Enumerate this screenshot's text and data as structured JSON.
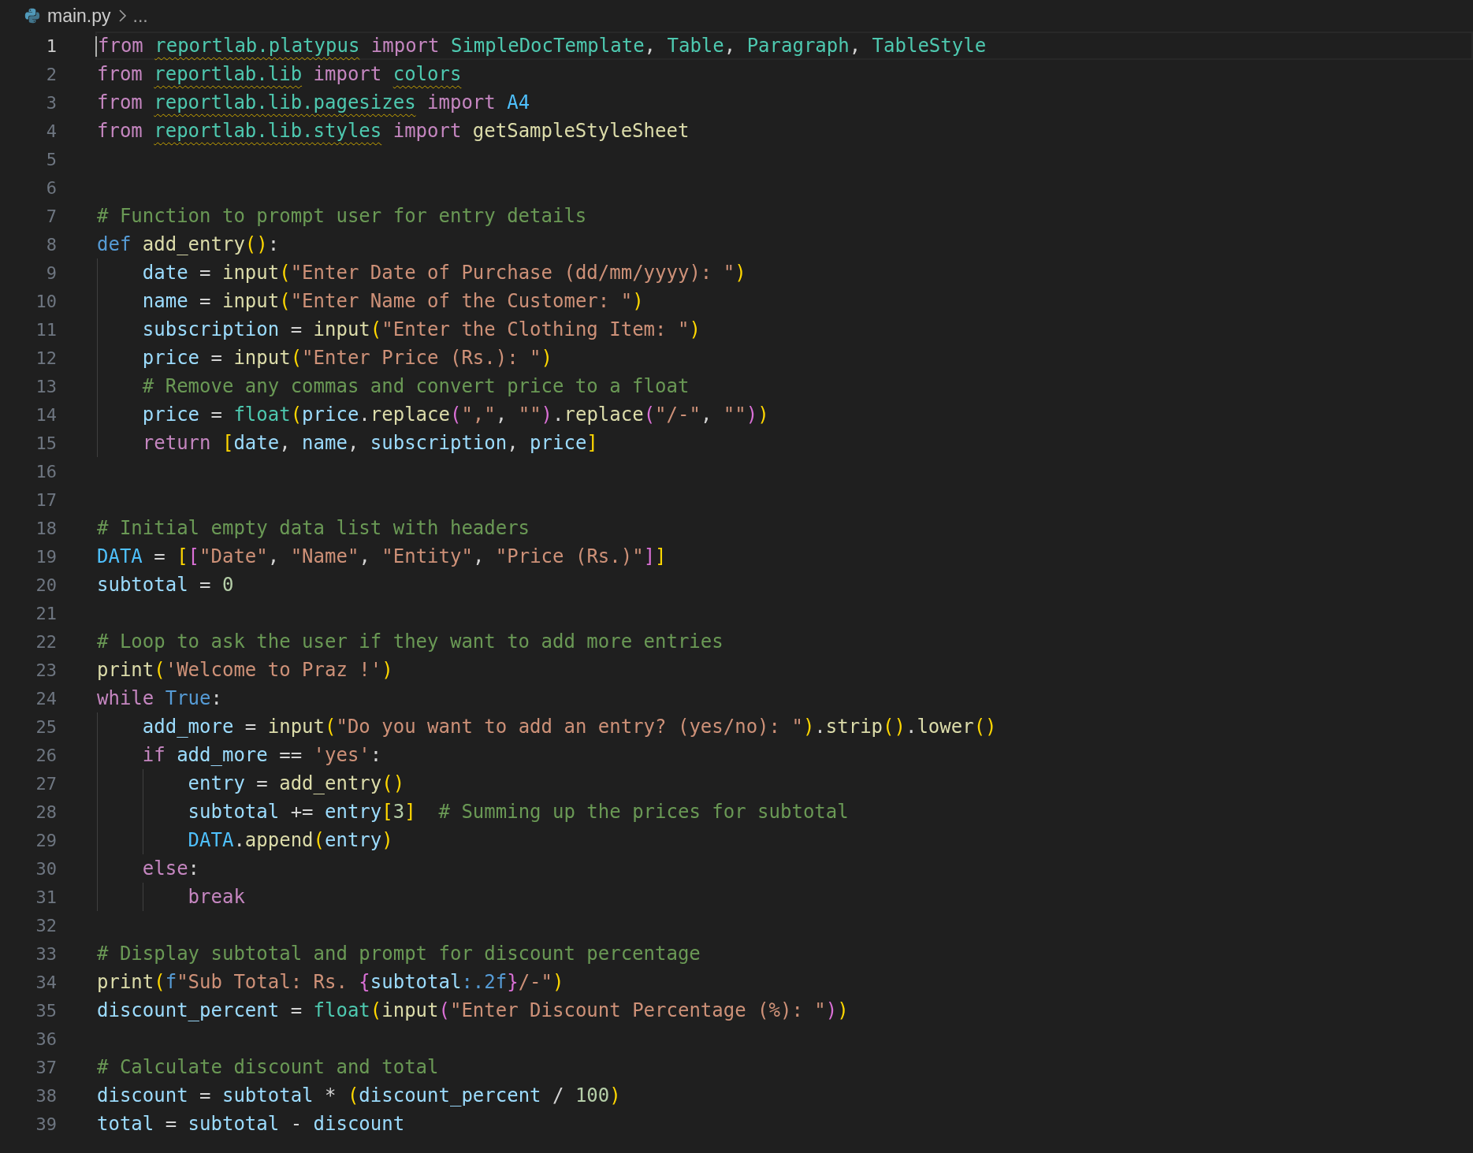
{
  "breadcrumb": {
    "file": "main.py",
    "trail": "..."
  },
  "lines": [
    {
      "number": "1",
      "current": true,
      "tokens": [
        {
          "kind": "kw",
          "text": "from "
        },
        {
          "kind": "unresolved",
          "text": "reportlab.platypus"
        },
        {
          "kind": "kw",
          "text": " import "
        },
        {
          "kind": "cls",
          "text": "SimpleDocTemplate"
        },
        {
          "kind": "op",
          "text": ", "
        },
        {
          "kind": "cls",
          "text": "Table"
        },
        {
          "kind": "op",
          "text": ", "
        },
        {
          "kind": "cls",
          "text": "Paragraph"
        },
        {
          "kind": "op",
          "text": ", "
        },
        {
          "kind": "cls",
          "text": "TableStyle"
        }
      ]
    },
    {
      "number": "2",
      "current": false,
      "tokens": [
        {
          "kind": "kw",
          "text": "from "
        },
        {
          "kind": "unresolved",
          "text": "reportlab.lib"
        },
        {
          "kind": "kw",
          "text": " import "
        },
        {
          "kind": "unresolved",
          "text": "colors"
        }
      ]
    },
    {
      "number": "3",
      "current": false,
      "tokens": [
        {
          "kind": "kw",
          "text": "from "
        },
        {
          "kind": "unresolved",
          "text": "reportlab.lib.pagesizes"
        },
        {
          "kind": "kw",
          "text": " import "
        },
        {
          "kind": "const",
          "text": "A4"
        }
      ]
    },
    {
      "number": "4",
      "current": false,
      "tokens": [
        {
          "kind": "kw",
          "text": "from "
        },
        {
          "kind": "unresolved",
          "text": "reportlab.lib.styles"
        },
        {
          "kind": "kw",
          "text": " import "
        },
        {
          "kind": "fn",
          "text": "getSampleStyleSheet"
        }
      ]
    },
    {
      "number": "5",
      "current": false
    },
    {
      "number": "6",
      "current": false
    },
    {
      "number": "7",
      "current": false,
      "tokens": [
        {
          "kind": "cmt",
          "text": "# Function to prompt user for entry details"
        }
      ]
    },
    {
      "number": "8",
      "current": false,
      "tokens": [
        {
          "kind": "storage",
          "text": "def "
        },
        {
          "kind": "fn",
          "text": "add_entry"
        },
        {
          "kind": "b1",
          "text": "()"
        },
        {
          "kind": "op",
          "text": ":"
        }
      ]
    },
    {
      "number": "9",
      "current": false,
      "tokens": [
        {
          "kind": "var",
          "text": "    date"
        },
        {
          "kind": "op",
          "text": " = "
        },
        {
          "kind": "fn",
          "text": "input"
        },
        {
          "kind": "b1",
          "text": "("
        },
        {
          "kind": "str",
          "text": "\"Enter Date of Purchase (dd/mm/yyyy): \""
        },
        {
          "kind": "b1",
          "text": ")"
        }
      ]
    },
    {
      "number": "10",
      "current": false,
      "tokens": [
        {
          "kind": "var",
          "text": "    name"
        },
        {
          "kind": "op",
          "text": " = "
        },
        {
          "kind": "fn",
          "text": "input"
        },
        {
          "kind": "b1",
          "text": "("
        },
        {
          "kind": "str",
          "text": "\"Enter Name of the Customer: \""
        },
        {
          "kind": "b1",
          "text": ")"
        }
      ]
    },
    {
      "number": "11",
      "current": false,
      "tokens": [
        {
          "kind": "var",
          "text": "    subscription"
        },
        {
          "kind": "op",
          "text": " = "
        },
        {
          "kind": "fn",
          "text": "input"
        },
        {
          "kind": "b1",
          "text": "("
        },
        {
          "kind": "str",
          "text": "\"Enter the Clothing Item: \""
        },
        {
          "kind": "b1",
          "text": ")"
        }
      ]
    },
    {
      "number": "12",
      "current": false,
      "tokens": [
        {
          "kind": "var",
          "text": "    price"
        },
        {
          "kind": "op",
          "text": " = "
        },
        {
          "kind": "fn",
          "text": "input"
        },
        {
          "kind": "b1",
          "text": "("
        },
        {
          "kind": "str",
          "text": "\"Enter Price (Rs.): \""
        },
        {
          "kind": "b1",
          "text": ")"
        }
      ]
    },
    {
      "number": "13",
      "current": false,
      "tokens": [
        {
          "kind": "cmt",
          "text": "    # Remove any commas and convert price to a float"
        }
      ]
    },
    {
      "number": "14",
      "current": false,
      "tokens": [
        {
          "kind": "var",
          "text": "    price"
        },
        {
          "kind": "op",
          "text": " = "
        },
        {
          "kind": "cls",
          "text": "float"
        },
        {
          "kind": "b1",
          "text": "("
        },
        {
          "kind": "var",
          "text": "price"
        },
        {
          "kind": "op",
          "text": "."
        },
        {
          "kind": "fn",
          "text": "replace"
        },
        {
          "kind": "b2",
          "text": "("
        },
        {
          "kind": "str",
          "text": "\",\""
        },
        {
          "kind": "op",
          "text": ", "
        },
        {
          "kind": "str",
          "text": "\"\""
        },
        {
          "kind": "b2",
          "text": ")"
        },
        {
          "kind": "op",
          "text": "."
        },
        {
          "kind": "fn",
          "text": "replace"
        },
        {
          "kind": "b2",
          "text": "("
        },
        {
          "kind": "str",
          "text": "\"/-\""
        },
        {
          "kind": "op",
          "text": ", "
        },
        {
          "kind": "str",
          "text": "\"\""
        },
        {
          "kind": "b2",
          "text": ")"
        },
        {
          "kind": "b1",
          "text": ")"
        }
      ]
    },
    {
      "number": "15",
      "current": false,
      "tokens": [
        {
          "kind": "kw",
          "text": "    return "
        },
        {
          "kind": "b1",
          "text": "["
        },
        {
          "kind": "var",
          "text": "date"
        },
        {
          "kind": "op",
          "text": ", "
        },
        {
          "kind": "var",
          "text": "name"
        },
        {
          "kind": "op",
          "text": ", "
        },
        {
          "kind": "var",
          "text": "subscription"
        },
        {
          "kind": "op",
          "text": ", "
        },
        {
          "kind": "var",
          "text": "price"
        },
        {
          "kind": "b1",
          "text": "]"
        }
      ]
    },
    {
      "number": "16",
      "current": false
    },
    {
      "number": "17",
      "current": false
    },
    {
      "number": "18",
      "current": false,
      "tokens": [
        {
          "kind": "cmt",
          "text": "# Initial empty data list with headers"
        }
      ]
    },
    {
      "number": "19",
      "current": false,
      "tokens": [
        {
          "kind": "const",
          "text": "DATA"
        },
        {
          "kind": "op",
          "text": " = "
        },
        {
          "kind": "b1",
          "text": "["
        },
        {
          "kind": "b2",
          "text": "["
        },
        {
          "kind": "str",
          "text": "\"Date\""
        },
        {
          "kind": "op",
          "text": ", "
        },
        {
          "kind": "str",
          "text": "\"Name\""
        },
        {
          "kind": "op",
          "text": ", "
        },
        {
          "kind": "str",
          "text": "\"Entity\""
        },
        {
          "kind": "op",
          "text": ", "
        },
        {
          "kind": "str",
          "text": "\"Price (Rs.)\""
        },
        {
          "kind": "b2",
          "text": "]"
        },
        {
          "kind": "b1",
          "text": "]"
        }
      ]
    },
    {
      "number": "20",
      "current": false,
      "tokens": [
        {
          "kind": "var",
          "text": "subtotal"
        },
        {
          "kind": "op",
          "text": " = "
        },
        {
          "kind": "num",
          "text": "0"
        }
      ]
    },
    {
      "number": "21",
      "current": false
    },
    {
      "number": "22",
      "current": false,
      "tokens": [
        {
          "kind": "cmt",
          "text": "# Loop to ask the user if they want to add more entries"
        }
      ]
    },
    {
      "number": "23",
      "current": false,
      "tokens": [
        {
          "kind": "fn",
          "text": "print"
        },
        {
          "kind": "b1",
          "text": "("
        },
        {
          "kind": "str",
          "text": "'Welcome to Praz !'"
        },
        {
          "kind": "b1",
          "text": ")"
        }
      ]
    },
    {
      "number": "24",
      "current": false,
      "tokens": [
        {
          "kind": "kw",
          "text": "while "
        },
        {
          "kind": "storage",
          "text": "True"
        },
        {
          "kind": "op",
          "text": ":"
        }
      ]
    },
    {
      "number": "25",
      "current": false,
      "tokens": [
        {
          "kind": "var",
          "text": "    add_more"
        },
        {
          "kind": "op",
          "text": " = "
        },
        {
          "kind": "fn",
          "text": "input"
        },
        {
          "kind": "b1",
          "text": "("
        },
        {
          "kind": "str",
          "text": "\"Do you want to add an entry? (yes/no): \""
        },
        {
          "kind": "b1",
          "text": ")"
        },
        {
          "kind": "op",
          "text": "."
        },
        {
          "kind": "fn",
          "text": "strip"
        },
        {
          "kind": "b1",
          "text": "()"
        },
        {
          "kind": "op",
          "text": "."
        },
        {
          "kind": "fn",
          "text": "lower"
        },
        {
          "kind": "b1",
          "text": "()"
        }
      ]
    },
    {
      "number": "26",
      "current": false,
      "tokens": [
        {
          "kind": "kw",
          "text": "    if "
        },
        {
          "kind": "var",
          "text": "add_more"
        },
        {
          "kind": "op",
          "text": " == "
        },
        {
          "kind": "str",
          "text": "'yes'"
        },
        {
          "kind": "op",
          "text": ":"
        }
      ]
    },
    {
      "number": "27",
      "current": false,
      "tokens": [
        {
          "kind": "var",
          "text": "        entry"
        },
        {
          "kind": "op",
          "text": " = "
        },
        {
          "kind": "fn",
          "text": "add_entry"
        },
        {
          "kind": "b1",
          "text": "()"
        }
      ]
    },
    {
      "number": "28",
      "current": false,
      "tokens": [
        {
          "kind": "var",
          "text": "        subtotal"
        },
        {
          "kind": "op",
          "text": " += "
        },
        {
          "kind": "var",
          "text": "entry"
        },
        {
          "kind": "b1",
          "text": "["
        },
        {
          "kind": "num",
          "text": "3"
        },
        {
          "kind": "b1",
          "text": "]  "
        },
        {
          "kind": "cmt",
          "text": "# Summing up the prices for subtotal"
        }
      ]
    },
    {
      "number": "29",
      "current": false,
      "tokens": [
        {
          "kind": "const",
          "text": "        DATA"
        },
        {
          "kind": "op",
          "text": "."
        },
        {
          "kind": "fn",
          "text": "append"
        },
        {
          "kind": "b1",
          "text": "("
        },
        {
          "kind": "var",
          "text": "entry"
        },
        {
          "kind": "b1",
          "text": ")"
        }
      ]
    },
    {
      "number": "30",
      "current": false,
      "tokens": [
        {
          "kind": "kw",
          "text": "    else"
        },
        {
          "kind": "op",
          "text": ":"
        }
      ]
    },
    {
      "number": "31",
      "current": false,
      "tokens": [
        {
          "kind": "kw",
          "text": "        break"
        }
      ]
    },
    {
      "number": "32",
      "current": false
    },
    {
      "number": "33",
      "current": false,
      "tokens": [
        {
          "kind": "cmt",
          "text": "# Display subtotal and prompt for discount percentage"
        }
      ]
    },
    {
      "number": "34",
      "current": false,
      "tokens": [
        {
          "kind": "fn",
          "text": "print"
        },
        {
          "kind": "b1",
          "text": "("
        },
        {
          "kind": "storage",
          "text": "f"
        },
        {
          "kind": "str",
          "text": "\"Sub Total: Rs. "
        },
        {
          "kind": "b2",
          "text": "{"
        },
        {
          "kind": "var",
          "text": "subtotal"
        },
        {
          "kind": "storage",
          "text": ":.2f"
        },
        {
          "kind": "b2",
          "text": "}"
        },
        {
          "kind": "str",
          "text": "/-\""
        },
        {
          "kind": "b1",
          "text": ")"
        }
      ]
    },
    {
      "number": "35",
      "current": false,
      "tokens": [
        {
          "kind": "var",
          "text": "discount_percent"
        },
        {
          "kind": "op",
          "text": " = "
        },
        {
          "kind": "cls",
          "text": "float"
        },
        {
          "kind": "b1",
          "text": "("
        },
        {
          "kind": "fn",
          "text": "input"
        },
        {
          "kind": "b2",
          "text": "("
        },
        {
          "kind": "str",
          "text": "\"Enter Discount Percentage (%): \""
        },
        {
          "kind": "b2",
          "text": ")"
        },
        {
          "kind": "b1",
          "text": ")"
        }
      ]
    },
    {
      "number": "36",
      "current": false
    },
    {
      "number": "37",
      "current": false,
      "tokens": [
        {
          "kind": "cmt",
          "text": "# Calculate discount and total"
        }
      ]
    },
    {
      "number": "38",
      "current": false,
      "tokens": [
        {
          "kind": "var",
          "text": "discount"
        },
        {
          "kind": "op",
          "text": " = "
        },
        {
          "kind": "var",
          "text": "subtotal"
        },
        {
          "kind": "op",
          "text": " * "
        },
        {
          "kind": "b1",
          "text": "("
        },
        {
          "kind": "var",
          "text": "discount_percent"
        },
        {
          "kind": "op",
          "text": " / "
        },
        {
          "kind": "num",
          "text": "100"
        },
        {
          "kind": "b1",
          "text": ")"
        }
      ]
    },
    {
      "number": "39",
      "current": false,
      "tokens": [
        {
          "kind": "var",
          "text": "total"
        },
        {
          "kind": "op",
          "text": " = "
        },
        {
          "kind": "var",
          "text": "subtotal"
        },
        {
          "kind": "op",
          "text": " - "
        },
        {
          "kind": "var",
          "text": "discount"
        }
      ]
    }
  ]
}
